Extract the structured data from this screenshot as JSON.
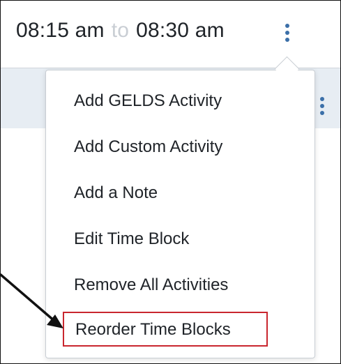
{
  "header": {
    "start_time": "08:15 am",
    "to_word": "to",
    "end_time": "08:30 am"
  },
  "menu": {
    "items": [
      "Add GELDS Activity",
      "Add Custom Activity",
      "Add a Note",
      "Edit Time Block",
      "Remove All Activities",
      "Reorder Time Blocks"
    ],
    "highlighted_item": "Reorder Time Blocks"
  },
  "icons": {
    "header_menu": "vertical-ellipsis-icon",
    "row_menu": "vertical-ellipsis-icon",
    "annotation": "callout-arrow"
  },
  "colors": {
    "accent": "#3b6fa8",
    "highlight": "#c9262e",
    "row_background": "#e7edf3",
    "to_word": "#c9ced4"
  }
}
